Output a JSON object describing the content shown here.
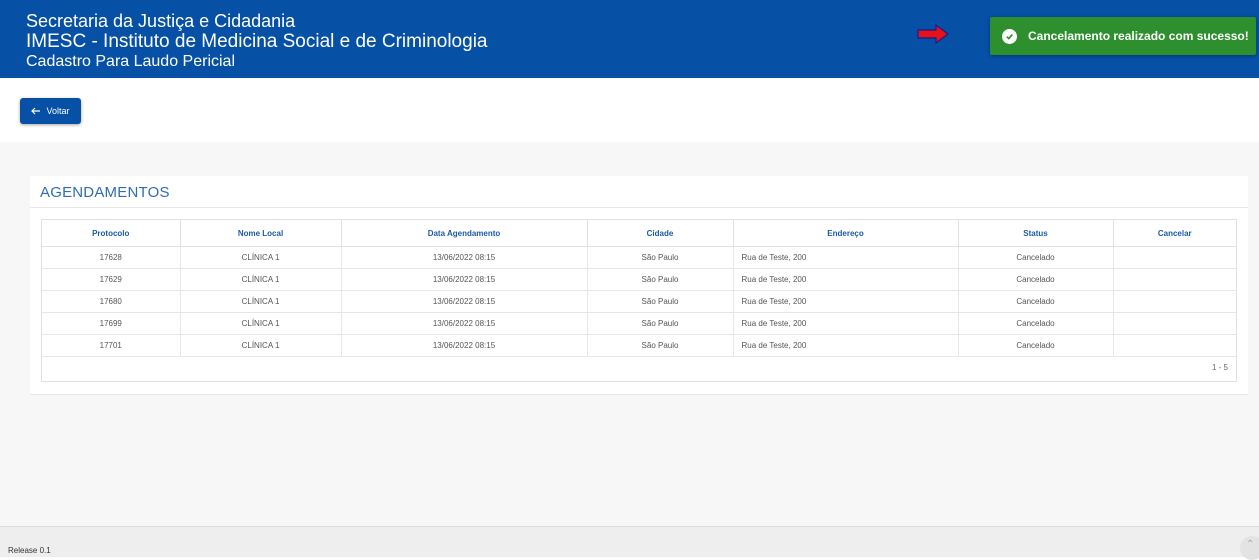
{
  "header": {
    "line1": "Secretaria da Justiça e Cidadania",
    "line2": "IMESC - Instituto de Medicina Social e de Criminologia",
    "line3": "Cadastro Para Laudo Pericial"
  },
  "toast": {
    "message": "Cancelamento realizado com sucesso!",
    "icon": "check-circle-icon",
    "color": "#2d8f2d"
  },
  "back_button": {
    "label": "Voltar",
    "icon": "arrow-left-icon"
  },
  "section": {
    "title": "AGENDAMENTOS"
  },
  "table": {
    "columns": [
      "Protocolo",
      "Nome Local",
      "Data Agendamento",
      "Cidade",
      "Endereço",
      "Status",
      "Cancelar"
    ],
    "rows": [
      {
        "protocolo": "17628",
        "local": "CLÍNICA 1",
        "data": "13/06/2022 08:15",
        "cidade": "São Paulo",
        "endereco": "Rua de Teste, 200",
        "status": "Cancelado",
        "cancelar": ""
      },
      {
        "protocolo": "17629",
        "local": "CLÍNICA 1",
        "data": "13/06/2022 08:15",
        "cidade": "São Paulo",
        "endereco": "Rua de Teste, 200",
        "status": "Cancelado",
        "cancelar": ""
      },
      {
        "protocolo": "17680",
        "local": "CLÍNICA 1",
        "data": "13/06/2022 08:15",
        "cidade": "São Paulo",
        "endereco": "Rua de Teste, 200",
        "status": "Cancelado",
        "cancelar": ""
      },
      {
        "protocolo": "17699",
        "local": "CLÍNICA 1",
        "data": "13/06/2022 08:15",
        "cidade": "São Paulo",
        "endereco": "Rua de Teste, 200",
        "status": "Cancelado",
        "cancelar": ""
      },
      {
        "protocolo": "17701",
        "local": "CLÍNICA 1",
        "data": "13/06/2022 08:15",
        "cidade": "São Paulo",
        "endereco": "Rua de Teste, 200",
        "status": "Cancelado",
        "cancelar": ""
      }
    ],
    "pagination": "1 - 5"
  },
  "footer": {
    "release": "Release 0.1"
  },
  "colors": {
    "header_bg": "#0651a6",
    "accent_text": "#2f6cb3",
    "annotation_arrow": "#e8101a"
  }
}
